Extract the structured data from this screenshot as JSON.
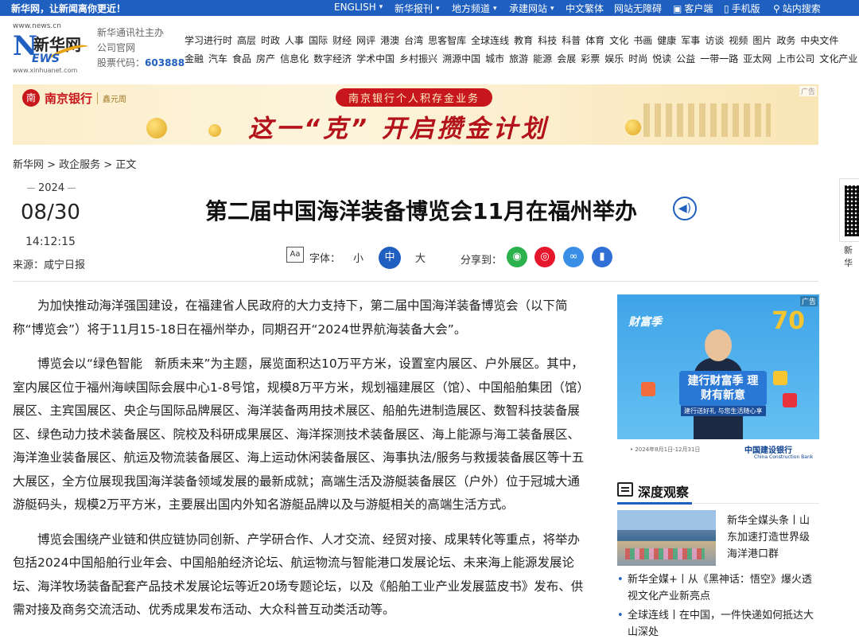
{
  "topbar": {
    "slogan": "新华网，让新闻离你更近！",
    "nav": [
      {
        "label": "ENGLISH",
        "caret": true
      },
      {
        "label": "新华报刊",
        "caret": true
      },
      {
        "label": "地方频道",
        "caret": true
      },
      {
        "label": "承建网站",
        "caret": true
      },
      {
        "label": "中文繁体",
        "caret": false
      },
      {
        "label": "网站无障碍",
        "caret": false
      },
      {
        "label": "客户端",
        "caret": false
      },
      {
        "label": "手机版",
        "caret": false
      },
      {
        "label": "站内搜索",
        "caret": false
      }
    ]
  },
  "logo": {
    "url": "www.news.cn",
    "n": "N",
    "cn": "新华网",
    "ews": "EWS",
    "sub": "www.xinhuanet.com"
  },
  "company": {
    "line1": "新华通讯社主办",
    "line2": "公司官网",
    "code_label": "股票代码：",
    "code": "603888"
  },
  "mainnav": {
    "row1": [
      "学习进行时",
      "高层",
      "时政",
      "人事",
      "国际",
      "财经",
      "网评",
      "港澳",
      "台湾",
      "思客智库",
      "全球连线",
      "教育",
      "科技",
      "科普",
      "体育",
      "文化",
      "书画",
      "健康",
      "军事",
      "访谈",
      "视频",
      "图片",
      "政务",
      "中央文件"
    ],
    "row2": [
      "金融",
      "汽车",
      "食品",
      "房产",
      "信息化",
      "数字经济",
      "学术中国",
      "乡村振兴",
      "溯源中国",
      "城市",
      "旅游",
      "能源",
      "会展",
      "彩票",
      "娱乐",
      "时尚",
      "悦读",
      "公益",
      "一带一路",
      "亚太网",
      "上市公司",
      "文化产业"
    ]
  },
  "banner": {
    "bank_mark": "南",
    "bank_name": "南京银行",
    "bank_sub": "鑫元周",
    "pill": "南京银行个人积存金业务",
    "slogan": "这一“克” 开启攒金计划",
    "ad_tag": "广告"
  },
  "breadcrumb": "新华网 > 政企服务 > 正文",
  "date": {
    "year": "2024",
    "month_day": "08/30",
    "time": "14:12:15"
  },
  "source": "来源：咸宁日报",
  "title": "第二届中国海洋装备博览会11月在福州举办",
  "toolbar": {
    "font_icon": "Aa",
    "font_label": "字体：",
    "sizes": [
      "小",
      "中",
      "大"
    ],
    "share_label": "分享到："
  },
  "article": [
    "为加快推动海洋强国建设，在福建省人民政府的大力支持下，第二届中国海洋装备博览会（以下简称“博览会”）将于11月15-18日在福州举办，同期召开“2024世界航海装备大会”。",
    "博览会以“绿色智能　新质未来”为主题，展览面积达10万平方米，设置室内展区、户外展区。其中，室内展区位于福州海峡国际会展中心1-8号馆，规模8万平方米，规划福建展区（馆）、中国船舶集团（馆）展区、主宾国展区、央企与国际品牌展区、海洋装备两用技术展区、船舶先进制造展区、数智科技装备展区、绿色动力技术装备展区、院校及科研成果展区、海洋探测技术装备展区、海上能源与海工装备展区、海洋渔业装备展区、航运及物流装备展区、海上运动休闲装备展区、海事执法/服务与救援装备展区等十五大展区，全方位展现我国海洋装备领域发展的最新成就；高端生活及游艇装备展区（户外）位于冠城大通游艇码头，规模2万平方米，主要展出国内外知名游艇品牌以及与游艇相关的高端生活方式。",
    "博览会围绕产业链和供应链协同创新、产学研合作、人才交流、经贸对接、成果转化等重点，将举办包括2024中国船舶行业年会、中国船舶经济论坛、航运物流与智能港口发展论坛、未来海上能源发展论坛、海洋牧场装备配套产品技术发展论坛等近20场专题论坛，以及《船舶工业产业发展蓝皮书》发布、供需对接及商务交流活动、优秀成果发布活动、大众科普互动类活动等。"
  ],
  "side_ad": {
    "ad_tag": "广告",
    "brand": "财富季",
    "seventy": "70",
    "bubble": "建行财富季 理财有新意",
    "small": "建行送好礼 与您生活随心享",
    "bank": "中国建设银行",
    "bank_en": "China Construction Bank",
    "date": "• 2024年8月1日-12月31日"
  },
  "deep": {
    "heading": "深度观察",
    "lead": "新华全媒头条丨山东加速打造世界级海洋港口群",
    "items": [
      "新华全媒+丨从《黑神话：悟空》爆火透视文化产业新亮点",
      "全球连线丨在中国，一件快递如何抵达大山深处"
    ]
  },
  "float": {
    "label": "新华"
  },
  "colors": {
    "brand_blue": "#1f5fbf",
    "wechat": "#2bb24c",
    "weibo": "#e6162d",
    "link": "#3a8ee6",
    "ipad": "#2f6fd6"
  }
}
